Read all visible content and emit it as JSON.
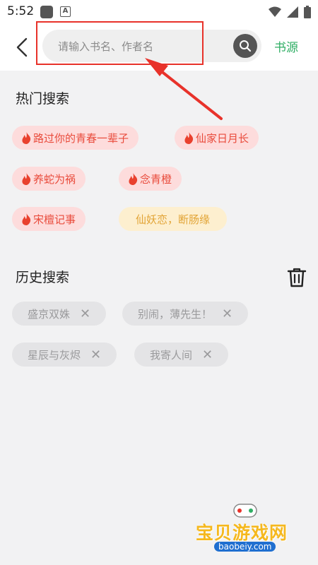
{
  "status_bar": {
    "time": "5:52"
  },
  "header": {
    "search_placeholder": "请输入书名、作者名",
    "source_label": "书源"
  },
  "hot_search": {
    "title": "热门搜索",
    "tags": [
      {
        "label": "路过你的青春一辈子",
        "fire": true
      },
      {
        "label": "仙家日月长",
        "fire": true
      },
      {
        "label": "养蛇为祸",
        "fire": true
      },
      {
        "label": "念青橙",
        "fire": true
      },
      {
        "label": "宋檀记事",
        "fire": true
      },
      {
        "label": "仙妖恋，断肠缘",
        "fire": false
      }
    ]
  },
  "history": {
    "title": "历史搜索",
    "items": [
      "盛京双姝",
      "别闹，薄先生！",
      "星辰与灰烬",
      "我寄人间"
    ]
  },
  "watermark": {
    "title": "宝贝游戏网",
    "site": "baobeiy.com"
  }
}
